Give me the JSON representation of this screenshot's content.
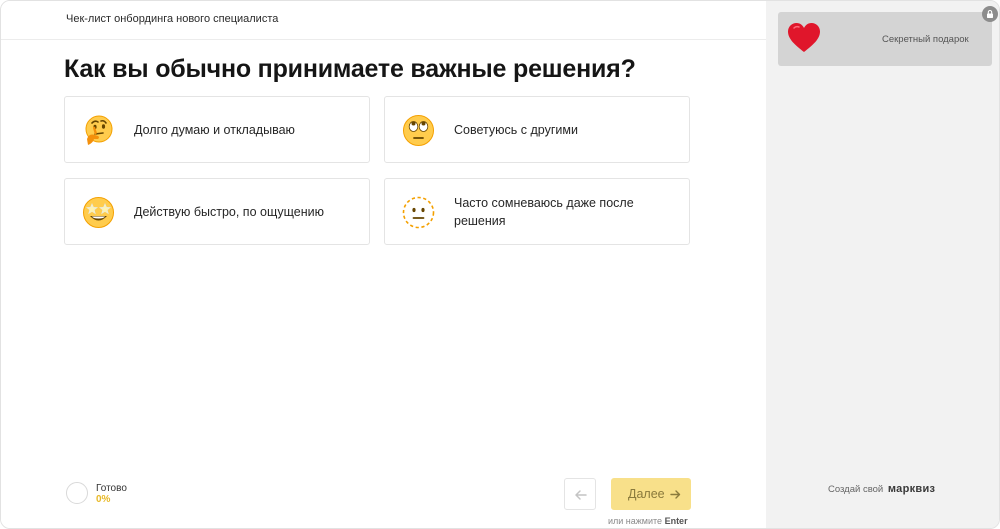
{
  "header": {
    "title": "Чек-лист онбординга нового специалиста"
  },
  "question": {
    "text": "Как вы обычно принимаете важные решения?"
  },
  "answers": [
    {
      "label": "Долго думаю и откладываю",
      "icon": "thinking-face-emoji"
    },
    {
      "label": "Советуюсь с другими",
      "icon": "rolling-eyes-emoji"
    },
    {
      "label": "Действую быстро, по ощущению",
      "icon": "star-struck-emoji"
    },
    {
      "label": "Часто сомневаюсь даже после решения",
      "icon": "dotted-line-face-emoji"
    }
  ],
  "progress": {
    "label": "Готово",
    "value": "0%",
    "fraction": 0
  },
  "navigation": {
    "back_icon": "arrow-left-icon",
    "next_label": "Далее",
    "next_icon": "arrow-right-icon",
    "hint_prefix": "или нажмите",
    "hint_key": "Enter"
  },
  "sidebar": {
    "gift_label": "Секретный подарок",
    "gift_icon": "heart-icon",
    "lock_icon": "lock-icon",
    "brand_prefix": "Создай свой",
    "brand_name": "марквиз"
  },
  "colors": {
    "accent": "#f8e08a",
    "progress_text": "#e8b928",
    "sidebar_bg": "#f2f2f2",
    "gift_bg": "#d4d4d4",
    "heart": "#e0162b"
  }
}
